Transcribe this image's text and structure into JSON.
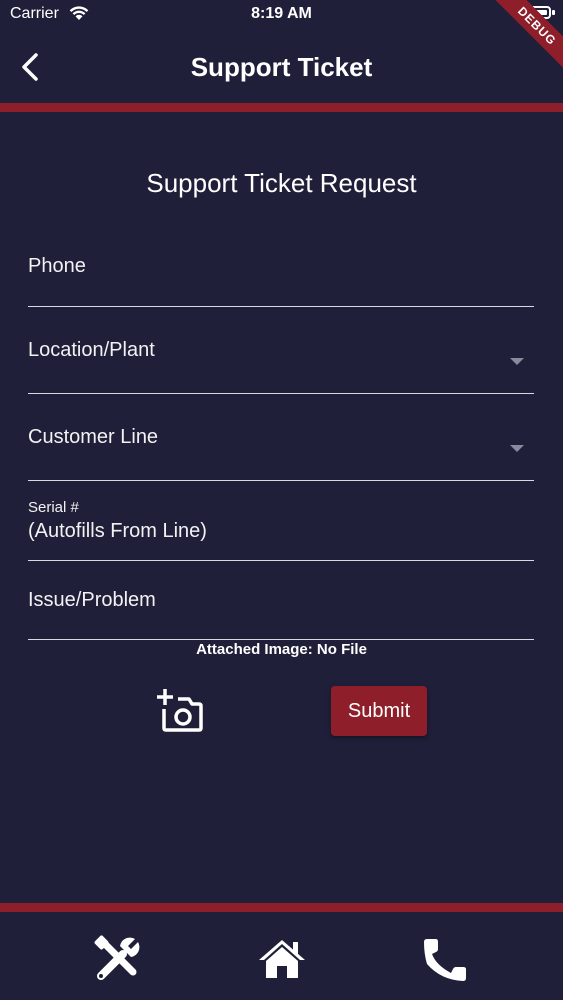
{
  "status_bar": {
    "carrier": "Carrier",
    "time": "8:19 AM"
  },
  "debug_banner": "DEBUG",
  "app_bar": {
    "title": "Support Ticket"
  },
  "form": {
    "title": "Support Ticket Request",
    "phone_label": "Phone",
    "location_label": "Location/Plant",
    "customer_line_label": "Customer Line",
    "serial_label": "Serial #",
    "serial_value": "(Autofills From Line)",
    "issue_label": "Issue/Problem",
    "attached_image": "Attached Image: No File",
    "submit_label": "Submit"
  },
  "bottom_nav": {
    "items": [
      {
        "icon": "tools-icon"
      },
      {
        "icon": "home-icon"
      },
      {
        "icon": "phone-icon"
      }
    ]
  },
  "colors": {
    "background": "#1f1f3a",
    "accent": "#8e1f2a",
    "text": "#ffffff"
  }
}
